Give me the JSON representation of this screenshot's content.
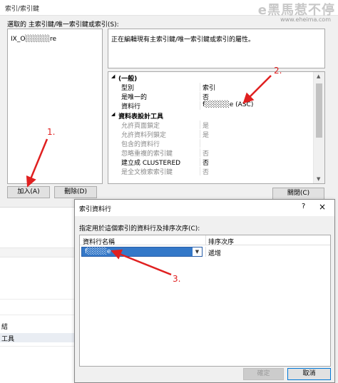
{
  "main_dialog": {
    "title": "索引/索引鍵",
    "selection_label": "選取的 主索引鍵/唯一索引鍵或索引(S):",
    "index_list": [
      "IX_O░░░░░re"
    ],
    "description": "正在編輯現有主索引鍵/唯一索引鍵或索引的屬性。",
    "add_button": "加入(A)",
    "remove_button": "刪除(D)",
    "close_button": "關閉(C)"
  },
  "watermark": {
    "text": "e黑馬惹不停",
    "url": "www.eheima.com"
  },
  "property_grid": {
    "categories": [
      {
        "name": "(一般)",
        "rows": [
          {
            "name": "型別",
            "value": "索引",
            "disabled": false
          },
          {
            "name": "是唯一的",
            "value": "否",
            "disabled": false
          },
          {
            "name": "資料行",
            "value": "f░░░░░e (ASC)",
            "disabled": false
          }
        ]
      },
      {
        "name": "資料表設計工具",
        "rows": [
          {
            "name": "允許頁面鎖定",
            "value": "是",
            "disabled": true
          },
          {
            "name": "允許資料列鎖定",
            "value": "是",
            "disabled": true
          },
          {
            "name": "包含的資料行",
            "value": "",
            "disabled": true
          },
          {
            "name": "忽略重複的索引鍵",
            "value": "否",
            "disabled": true
          },
          {
            "name": "建立成 CLUSTERED",
            "value": "否",
            "disabled": false
          },
          {
            "name": "是全文檢索索引鍵",
            "value": "否",
            "disabled": true
          }
        ]
      }
    ]
  },
  "lower_area": {
    "row_1": "結",
    "row_2": "工具"
  },
  "sub_dialog": {
    "title": "索引資料行",
    "help_icon": "?",
    "close_icon": "×",
    "instruction": "指定用於這個索引的資料行及排序次序(C):",
    "column_header_name": "資料行名稱",
    "column_header_sort": "排序次序",
    "selected_column": "f░░░░e",
    "sort_order": "遞增",
    "ok_button": "確定",
    "cancel_button": "取消"
  },
  "annotations": {
    "label_1": "1.",
    "label_2": "2.",
    "label_3": "3.",
    "color": "#e02020"
  }
}
